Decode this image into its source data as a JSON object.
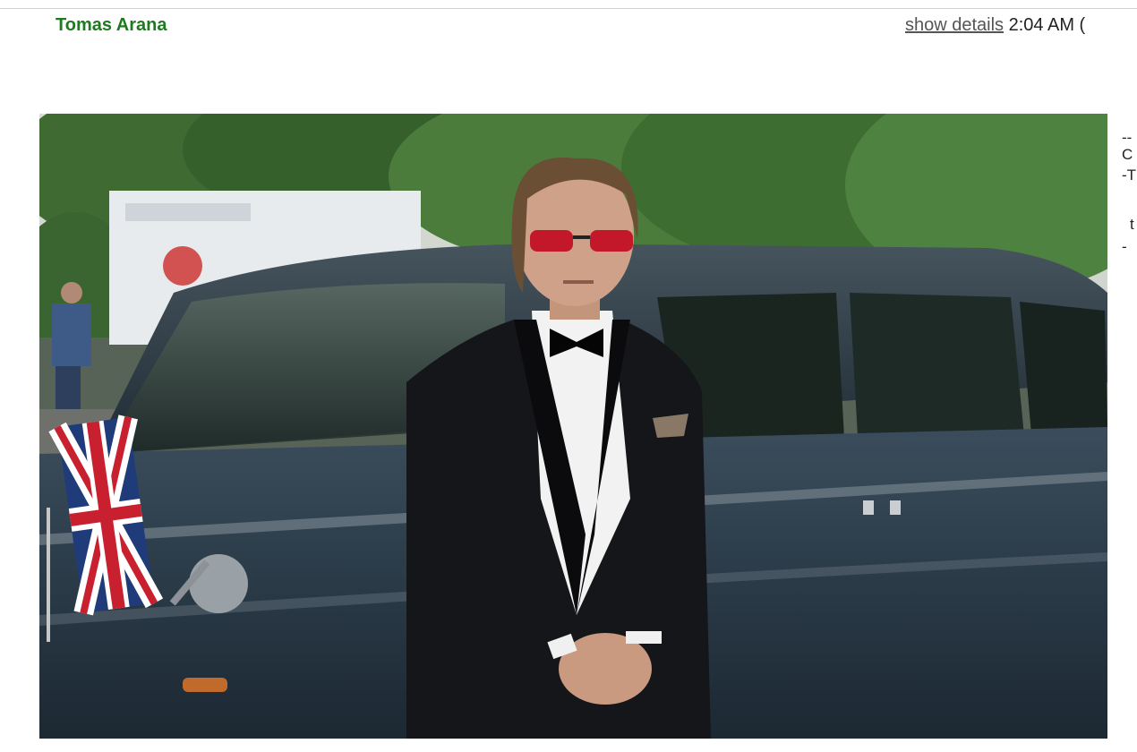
{
  "message": {
    "sender": "Tomas Arana",
    "show_details_label": "show details",
    "time": "2:04 AM ("
  },
  "photo": {
    "description_icon": "portrait-photo"
  },
  "side_snippet": {
    "line1": "--",
    "line2": "C",
    "line3": "-T",
    "line4": "t",
    "line5": "-"
  },
  "colors": {
    "sender": "#1e7a1e",
    "car_body": "#2b3b48",
    "sunglasses": "#c2182a"
  }
}
